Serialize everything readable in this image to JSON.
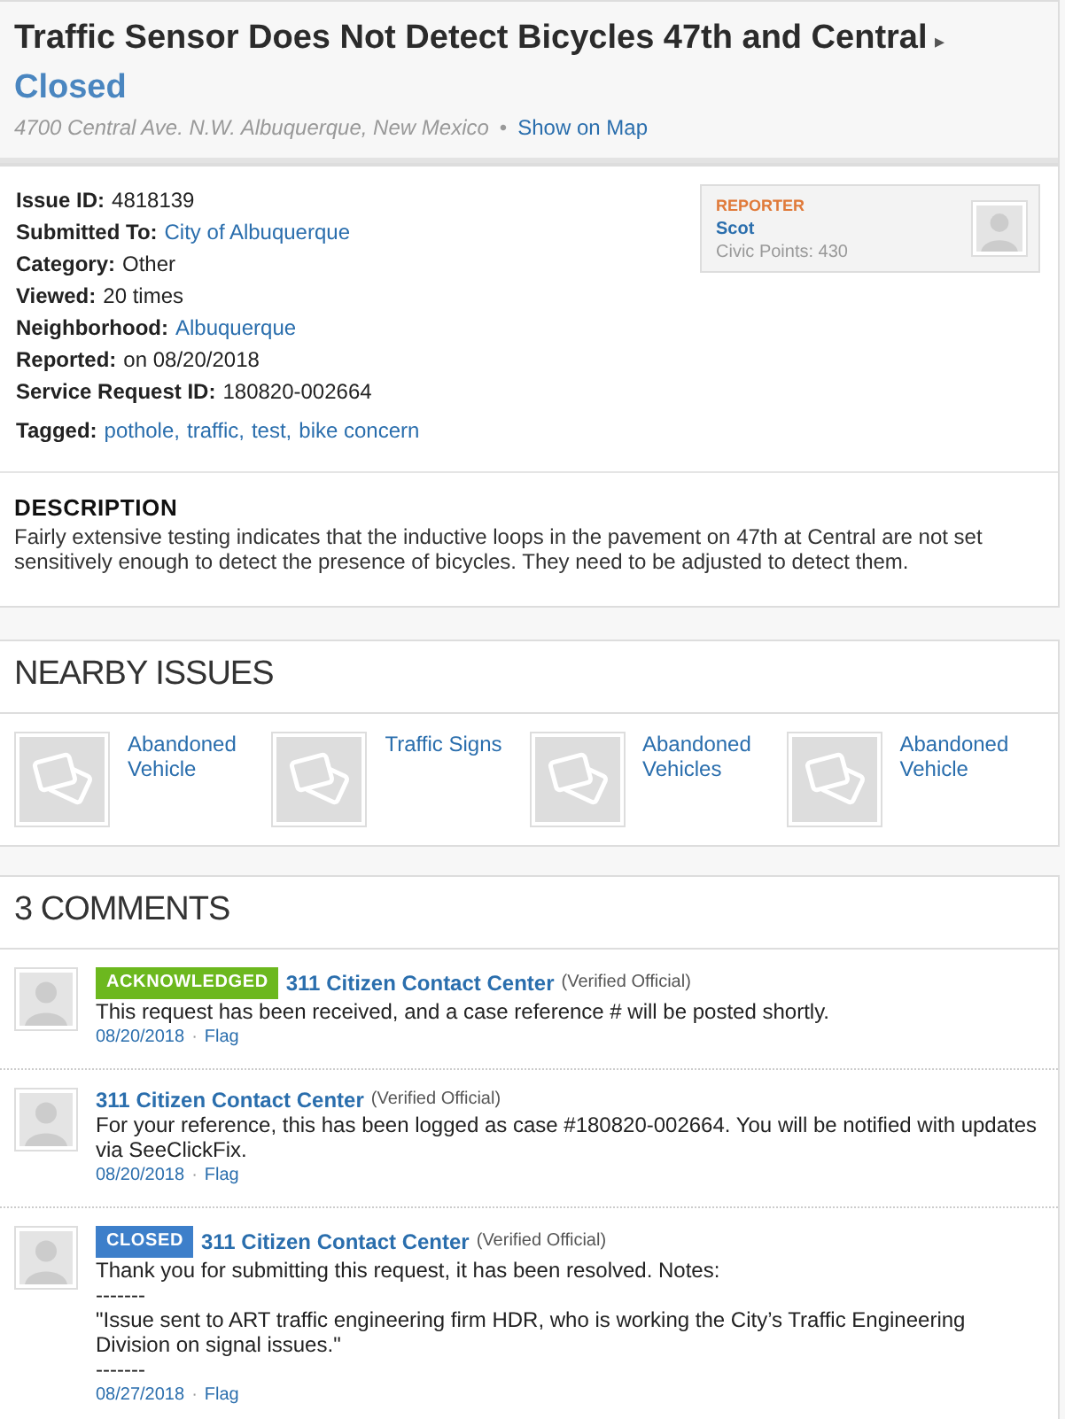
{
  "header": {
    "title": "Traffic Sensor Does Not Detect Bicycles 47th and Central",
    "arrow": "▸",
    "status": "Closed",
    "address": "4700 Central Ave. N.W. Albuquerque, New Mexico",
    "separator": "•",
    "map_link": "Show on Map"
  },
  "details": {
    "fields": [
      {
        "label": "Issue ID:",
        "value": "4818139",
        "kind": "text"
      },
      {
        "label": "Submitted To:",
        "value": "City of Albuquerque",
        "kind": "link"
      },
      {
        "label": "Category:",
        "value": "Other",
        "kind": "text"
      },
      {
        "label": "Viewed:",
        "value": "20 times",
        "kind": "text"
      },
      {
        "label": "Neighborhood:",
        "value": "Albuquerque",
        "kind": "link"
      },
      {
        "label": "Reported:",
        "value": "on 08/20/2018",
        "kind": "text"
      },
      {
        "label": "Service Request ID:",
        "value": "180820-002664",
        "kind": "text"
      }
    ],
    "tagged": {
      "label": "Tagged:",
      "tags": [
        "pothole,",
        "traffic,",
        "test,",
        "bike concern"
      ]
    },
    "reporter": {
      "heading": "REPORTER",
      "name": "Scot",
      "points": "Civic Points: 430"
    }
  },
  "description": {
    "heading": "DESCRIPTION",
    "text": "Fairly extensive testing indicates that the inductive loops in the pavement on 47th at Central are not set sensitively enough to detect the presence of bicycles. They need to be adjusted to detect them."
  },
  "nearby": {
    "heading": "NEARBY ISSUES",
    "items": [
      {
        "title": "Abandoned Vehicle"
      },
      {
        "title": "Traffic Signs"
      },
      {
        "title": "Abandoned Vehicles"
      },
      {
        "title": "Abandoned Vehicle"
      }
    ]
  },
  "comments": {
    "heading": "3 COMMENTS",
    "items": [
      {
        "badge": {
          "label": "ACKNOWLEDGED",
          "color": "#6cb81e"
        },
        "author": "311 Citizen Contact Center",
        "role": "(Verified Official)",
        "lines": [
          "This request has been received, and a case reference # will be posted shortly."
        ],
        "date": "08/20/2018",
        "separator": "·",
        "flag": "Flag"
      },
      {
        "author": "311 Citizen Contact Center",
        "role": "(Verified Official)",
        "lines": [
          "For your reference, this has been logged as case #180820-002664. You will be notified with updates via SeeClickFix."
        ],
        "date": "08/20/2018",
        "separator": "·",
        "flag": "Flag"
      },
      {
        "badge": {
          "label": "CLOSED",
          "color": "#3d7fca"
        },
        "author": "311 Citizen Contact Center",
        "role": "(Verified Official)",
        "lines": [
          "Thank you for submitting this request, it has been resolved. Notes:",
          "-------",
          "\"Issue sent to ART traffic engineering firm HDR, who is working the City’s Traffic Engineering Division on signal issues.\"",
          "-------"
        ],
        "date": "08/27/2018",
        "separator": "·",
        "flag": "Flag"
      }
    ]
  }
}
